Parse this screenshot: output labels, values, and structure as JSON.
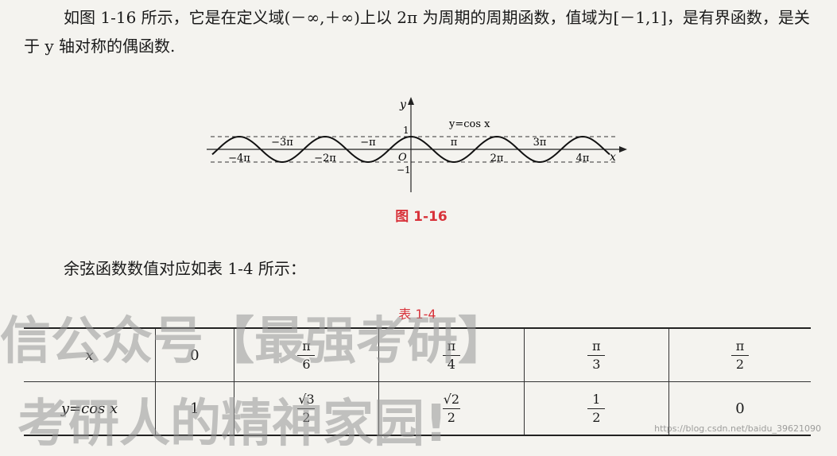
{
  "para1": "如图 1-16 所示，它是在定义域(－∞,＋∞)上以 2π 为周期的周期函数，值域为[－1,1]，是有界函数，是关于 y 轴对称的偶函数.",
  "figure": {
    "caption": "图 1-16",
    "curve_label": "y=cos x",
    "axis_x": "x",
    "axis_y": "y",
    "origin": "O",
    "y_ticks": [
      "1",
      "−1"
    ],
    "x_ticks_top": [
      "−3π",
      "−π",
      "π",
      "3π"
    ],
    "x_ticks_bottom": [
      "−4π",
      "−2π",
      "2π",
      "4π"
    ]
  },
  "para2": "余弦函数数值对应如表 1-4 所示：",
  "table": {
    "caption": "表 1-4",
    "row1_header": "x",
    "row2_header": "y=cos x",
    "row1": [
      {
        "num": "0"
      },
      {
        "num": "π",
        "den": "6"
      },
      {
        "num": "π",
        "den": "4"
      },
      {
        "num": "π",
        "den": "3"
      },
      {
        "num": "π",
        "den": "2"
      }
    ],
    "row2": [
      {
        "num": "1"
      },
      {
        "num": "√3",
        "den": "2"
      },
      {
        "num": "√2",
        "den": "2"
      },
      {
        "num": "1",
        "den": "2"
      },
      {
        "num": "0"
      }
    ]
  },
  "watermark_line1": "信公众号【最强考研】",
  "watermark_line2": "考研人的精神家园!",
  "url": "https://blog.csdn.net/baidu_39621090"
}
